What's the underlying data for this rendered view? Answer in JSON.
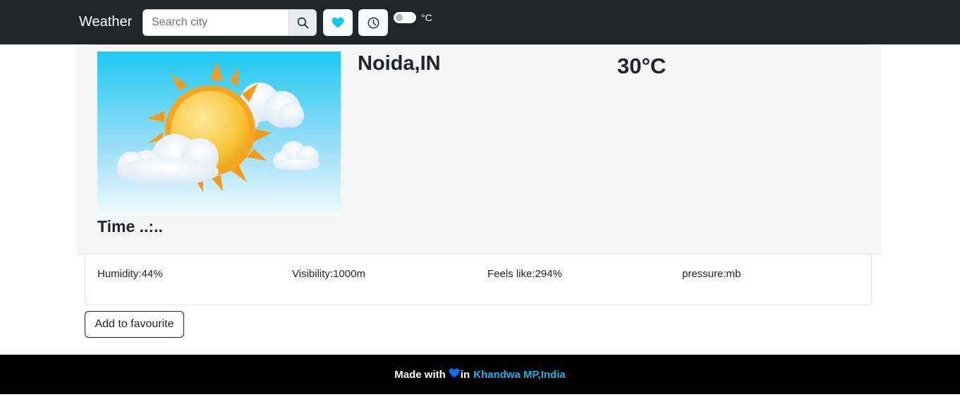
{
  "navbar": {
    "brand": "Weather",
    "search": {
      "placeholder": "Search city",
      "value": ""
    },
    "unit_label": "°C",
    "unit_toggle_on": false
  },
  "weather": {
    "city": "Noida,IN",
    "temperature": "30°C",
    "time": "Time ..:..",
    "humidity": "Humidity:44%",
    "visibility": "Visibility:1000m",
    "feels_like": "Feels like:294%",
    "pressure": "pressure:mb"
  },
  "actions": {
    "add_favourite": "Add to favourite"
  },
  "footer": {
    "made_with": "Made with",
    "in_text": "in",
    "place": "Khandwa MP,India"
  },
  "icons": [
    "search-icon",
    "heart-icon",
    "clock-icon",
    "sun-cloud-illustration"
  ],
  "colors": {
    "navbar": "#212529",
    "accent": "#17b3e6",
    "heart": "#0dcaf0",
    "footer": "#000000"
  }
}
